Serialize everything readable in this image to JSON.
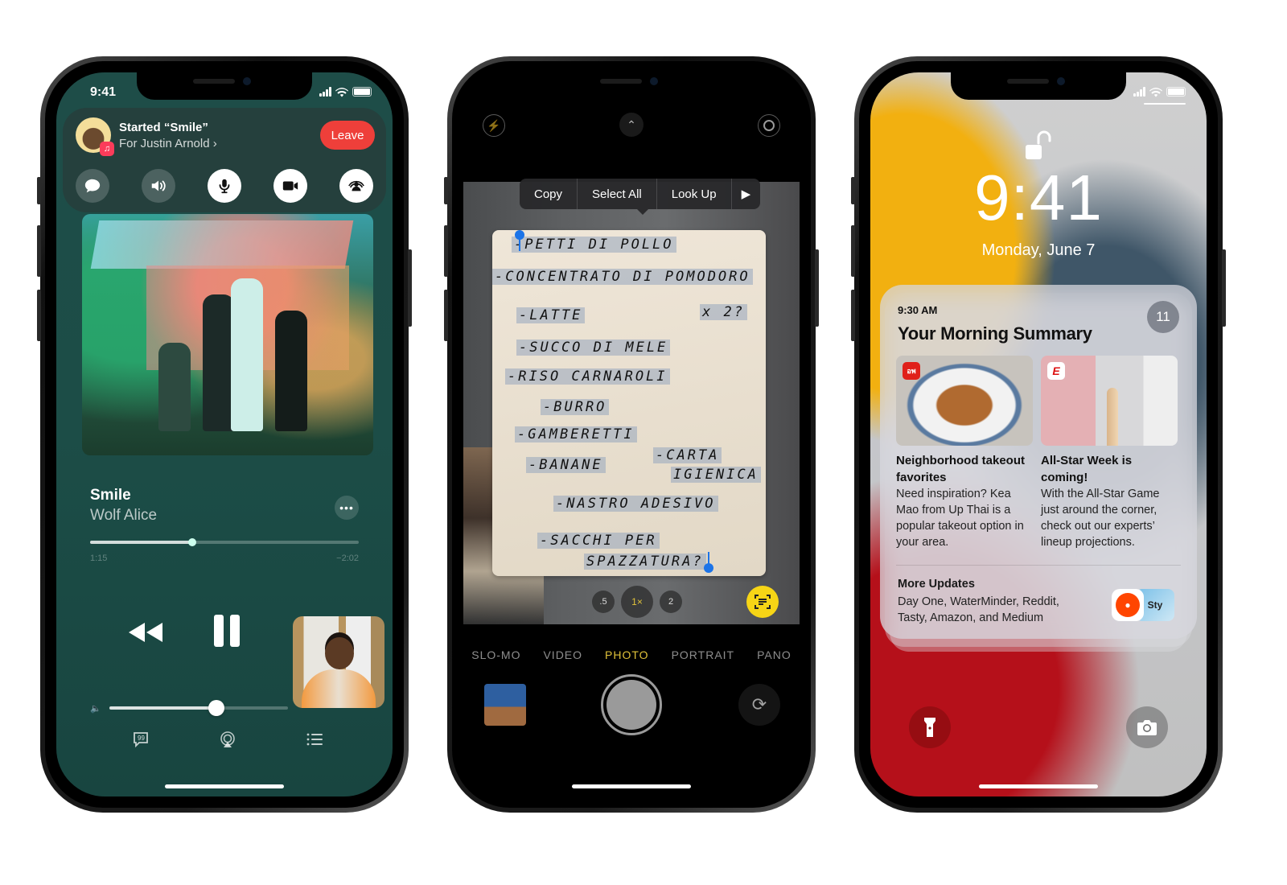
{
  "phones": {
    "shareplay": {
      "status": {
        "time": "9:41"
      },
      "banner": {
        "title": "Started “Smile”",
        "subtitle": "For Justin Arnold ›",
        "leave_label": "Leave"
      },
      "call_controls": [
        {
          "icon": "message-icon",
          "label": "Messages"
        },
        {
          "icon": "speaker-icon",
          "label": "Speaker"
        },
        {
          "icon": "microphone-icon",
          "label": "Mute"
        },
        {
          "icon": "video-camera-icon",
          "label": "Camera"
        },
        {
          "icon": "shareplay-icon",
          "label": "SharePlay"
        }
      ],
      "now_playing": {
        "title": "Smile",
        "artist": "Wolf Alice",
        "more_label": "•••",
        "elapsed": "1:15",
        "remaining": "−2:02",
        "progress": 0.38,
        "volume": 0.6
      },
      "bottom_actions": [
        {
          "icon": "lyrics-icon"
        },
        {
          "icon": "airplay-icon"
        },
        {
          "icon": "queue-list-icon"
        }
      ]
    },
    "camera": {
      "context_menu": [
        "Copy",
        "Select All",
        "Look Up",
        "▶"
      ],
      "recognized_text": [
        "-PETTI DI POLLO",
        "-CONCENTRATO DI POMODORO",
        "-LATTE",
        "x 2?",
        "-SUCCO DI MELE",
        "-RISO CARNAROLI",
        "-BURRO",
        "-GAMBERETTI",
        "-BANANE",
        "-CARTA",
        "IGIENICA",
        "-NASTRO ADESIVO",
        "-SACCHI PER",
        "SPAZZATURA?"
      ],
      "zoom_levels": [
        ".5",
        "1×",
        "2"
      ],
      "active_zoom": "1×",
      "modes": [
        "SLO-MO",
        "VIDEO",
        "PHOTO",
        "PORTRAIT",
        "PANO"
      ],
      "active_mode": "PHOTO",
      "accent": "#e0c23a"
    },
    "lockscreen": {
      "time": "9:41",
      "date": "Monday, June 7",
      "summary": {
        "time": "9:30 AM",
        "title": "Your Morning Summary",
        "count": "11",
        "stories": [
          {
            "app": "Up Thai",
            "badge": "อพ",
            "title": "Neighborhood takeout favorites",
            "body": "Need inspiration? Kea Mao from Up Thai is a popular takeout option in your area."
          },
          {
            "app": "ESPN",
            "badge": "E",
            "title": "All-Star Week is coming!",
            "body": "With the All-Star Game just around the corner, check out our experts’ lineup projections."
          }
        ],
        "more_title": "More Updates",
        "more_body": "Day One, WaterMinder, Reddit, Tasty, Amazon, and Medium",
        "tasty_label": "Sty"
      }
    }
  }
}
